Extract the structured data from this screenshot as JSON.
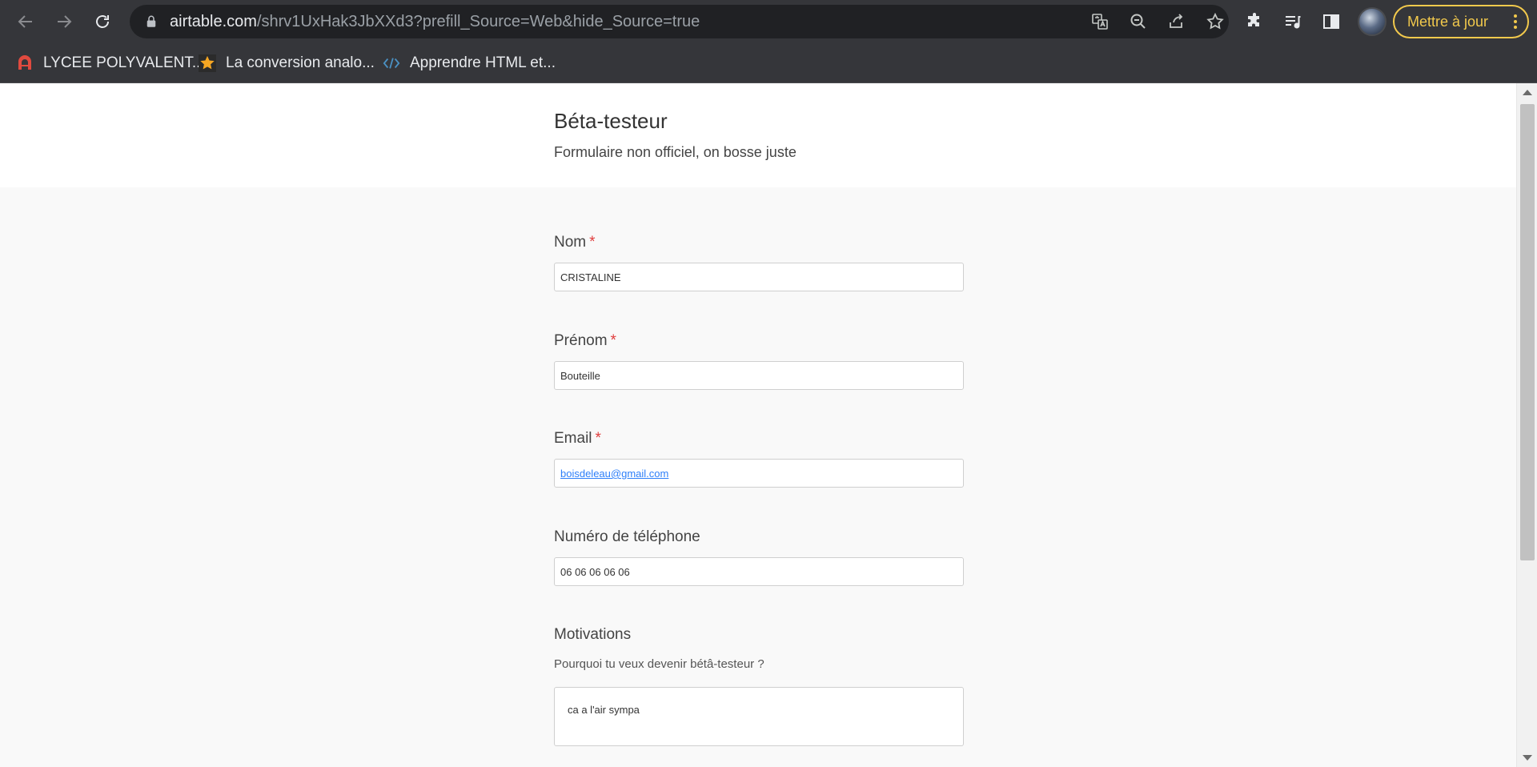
{
  "browser": {
    "url_host": "airtable.com",
    "url_path": "/shrv1UxHak3JbXXd3?prefill_Source=Web&hide_Source=true",
    "update_button_label": "Mettre à jour",
    "bookmarks": [
      {
        "label": "LYCEE POLYVALENT...",
        "icon": "lycee-logo-icon",
        "color": "#e04a3f"
      },
      {
        "label": "La conversion analo...",
        "icon": "star-icon",
        "color": "#f5a623"
      },
      {
        "label": "Apprendre HTML et...",
        "icon": "code-icon",
        "color": "#4a90c2"
      }
    ]
  },
  "form": {
    "title": "Béta-testeur",
    "description": "Formulaire non officiel, on bosse juste",
    "fields": [
      {
        "label": "Nom",
        "required_mark": "*",
        "value": "CRISTALINE"
      },
      {
        "label": "Prénom",
        "required_mark": "*",
        "value": "Bouteille"
      },
      {
        "label": "Email",
        "required_mark": "*",
        "value": "boisdeleau@gmail.com"
      },
      {
        "label": "Numéro de téléphone",
        "value": "06 06 06 06 06"
      },
      {
        "label": "Motivations",
        "help": "Pourquoi tu veux devenir bétâ-testeur ?",
        "value": "ca a l'air sympa"
      }
    ]
  },
  "colors": {
    "required": "#e03e3e",
    "link": "#2d7ff9",
    "update_accent": "#f2c94c"
  }
}
